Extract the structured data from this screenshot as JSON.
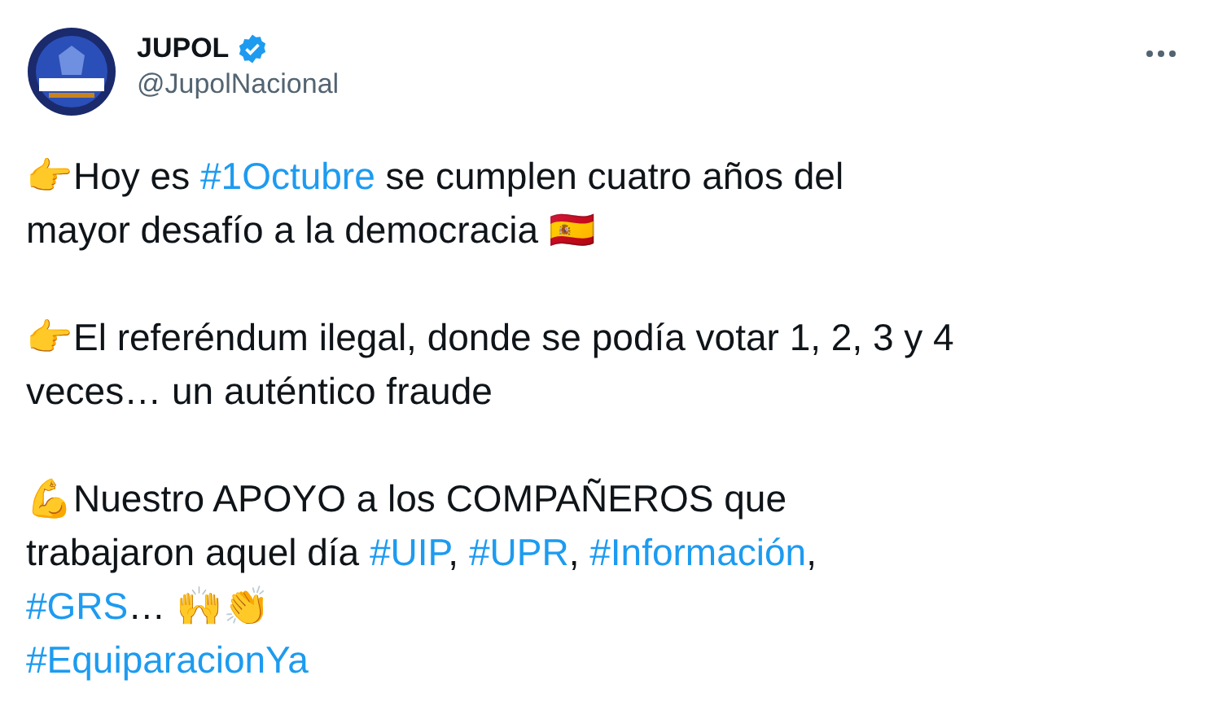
{
  "author": {
    "name": "JUPOL",
    "verified": true,
    "handle": "@JupolNacional"
  },
  "paragraphs": [
    [
      [
        {
          "kind": "text",
          "text": "👉Hoy es "
        },
        {
          "kind": "hashtag",
          "text": "#1Octubre"
        },
        {
          "kind": "text",
          "text": " se cumplen cuatro años del"
        }
      ],
      [
        {
          "kind": "text",
          "text": "mayor desafío a la democracia 🇪🇸"
        }
      ]
    ],
    [
      [
        {
          "kind": "text",
          "text": "👉El referéndum ilegal, donde se podía votar 1, 2, 3 y 4"
        }
      ],
      [
        {
          "kind": "text",
          "text": "veces… un auténtico fraude"
        }
      ]
    ],
    [
      [
        {
          "kind": "text",
          "text": "💪Nuestro APOYO a los COMPAÑEROS que"
        }
      ],
      [
        {
          "kind": "text",
          "text": "trabajaron aquel día "
        },
        {
          "kind": "hashtag",
          "text": "#UIP"
        },
        {
          "kind": "text",
          "text": ", "
        },
        {
          "kind": "hashtag",
          "text": "#UPR"
        },
        {
          "kind": "text",
          "text": ", "
        },
        {
          "kind": "hashtag",
          "text": "#Información"
        },
        {
          "kind": "text",
          "text": ","
        }
      ],
      [
        {
          "kind": "hashtag",
          "text": "#GRS"
        },
        {
          "kind": "text",
          "text": "… 🙌👏"
        }
      ],
      [
        {
          "kind": "hashtag",
          "text": "#EquiparacionYa"
        }
      ]
    ]
  ]
}
